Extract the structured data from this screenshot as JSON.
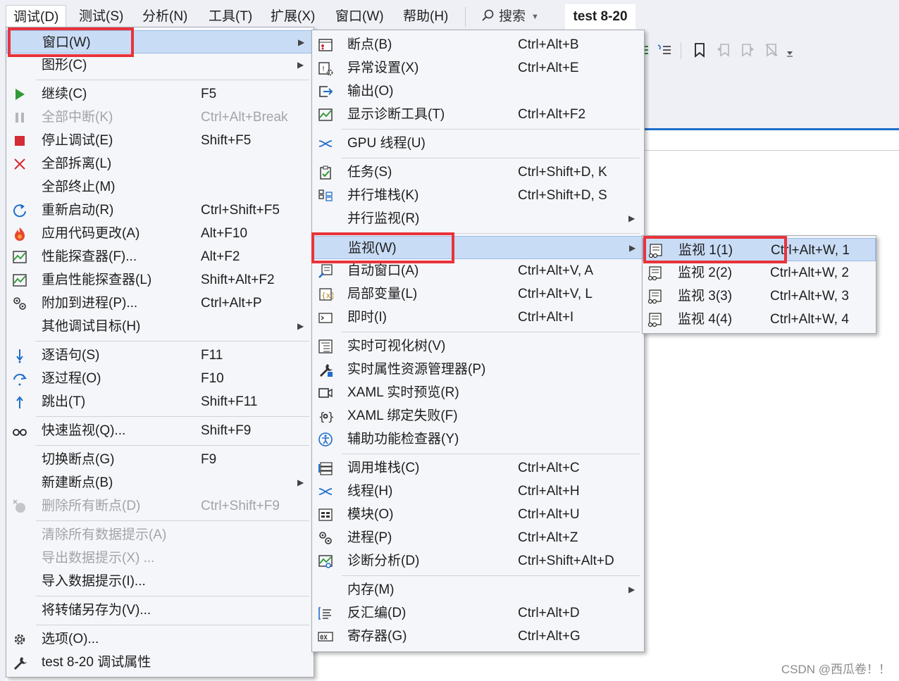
{
  "menubar": {
    "items": [
      "调试(D)",
      "测试(S)",
      "分析(N)",
      "工具(T)",
      "扩展(X)",
      "窗口(W)",
      "帮助(H)"
    ],
    "search_label": "搜索",
    "solution_title": "test 8-20"
  },
  "debug_menu": {
    "items": [
      {
        "label": "窗口(W)",
        "submenu": true,
        "highlighted": true,
        "icon": "none"
      },
      {
        "label": "图形(C)",
        "submenu": true,
        "icon": "none"
      },
      {
        "label": "继续(C)",
        "shortcut": "F5",
        "icon": "play-icon"
      },
      {
        "label": "全部中断(K)",
        "shortcut": "Ctrl+Alt+Break",
        "disabled": true,
        "icon": "pause-icon"
      },
      {
        "label": "停止调试(E)",
        "shortcut": "Shift+F5",
        "icon": "stop-icon"
      },
      {
        "label": "全部拆离(L)",
        "icon": "detach-icon"
      },
      {
        "label": "全部终止(M)",
        "icon": "none"
      },
      {
        "label": "重新启动(R)",
        "shortcut": "Ctrl+Shift+F5",
        "icon": "restart-icon"
      },
      {
        "label": "应用代码更改(A)",
        "shortcut": "Alt+F10",
        "icon": "hot-reload-icon"
      },
      {
        "label": "性能探查器(F)...",
        "shortcut": "Alt+F2",
        "icon": "profiler-icon"
      },
      {
        "label": "重启性能探查器(L)",
        "shortcut": "Shift+Alt+F2",
        "icon": "profiler-icon"
      },
      {
        "label": "附加到进程(P)...",
        "shortcut": "Ctrl+Alt+P",
        "icon": "attach-icon"
      },
      {
        "label": "其他调试目标(H)",
        "submenu": true,
        "icon": "none"
      },
      {
        "label": "逐语句(S)",
        "shortcut": "F11",
        "icon": "step-into-icon"
      },
      {
        "label": "逐过程(O)",
        "shortcut": "F10",
        "icon": "step-over-icon"
      },
      {
        "label": "跳出(T)",
        "shortcut": "Shift+F11",
        "icon": "step-out-icon"
      },
      {
        "label": "快速监视(Q)...",
        "shortcut": "Shift+F9",
        "icon": "glasses-icon"
      },
      {
        "label": "切换断点(G)",
        "shortcut": "F9",
        "icon": "none"
      },
      {
        "label": "新建断点(B)",
        "submenu": true,
        "icon": "none"
      },
      {
        "label": "删除所有断点(D)",
        "shortcut": "Ctrl+Shift+F9",
        "disabled": true,
        "icon": "delete-breakpoints-icon"
      },
      {
        "label": "清除所有数据提示(A)",
        "disabled": true,
        "icon": "none"
      },
      {
        "label": "导出数据提示(X) ...",
        "disabled": true,
        "icon": "none"
      },
      {
        "label": "导入数据提示(I)...",
        "icon": "none"
      },
      {
        "label": "将转储另存为(V)...",
        "icon": "none"
      },
      {
        "label": "选项(O)...",
        "icon": "gear-icon"
      },
      {
        "label": "test 8-20 调试属性",
        "icon": "wrench-icon"
      }
    ]
  },
  "window_submenu": {
    "items": [
      {
        "label": "断点(B)",
        "shortcut": "Ctrl+Alt+B",
        "icon": "breakpoints-window-icon"
      },
      {
        "label": "异常设置(X)",
        "shortcut": "Ctrl+Alt+E",
        "icon": "exception-settings-icon"
      },
      {
        "label": "输出(O)",
        "icon": "output-icon"
      },
      {
        "label": "显示诊断工具(T)",
        "shortcut": "Ctrl+Alt+F2",
        "icon": "diagnostic-tools-icon"
      },
      {
        "label": "GPU 线程(U)",
        "icon": "gpu-threads-icon"
      },
      {
        "label": "任务(S)",
        "shortcut": "Ctrl+Shift+D, K",
        "icon": "tasks-icon"
      },
      {
        "label": "并行堆栈(K)",
        "shortcut": "Ctrl+Shift+D, S",
        "icon": "parallel-stacks-icon"
      },
      {
        "label": "并行监视(R)",
        "submenu": true,
        "icon": "none"
      },
      {
        "label": "监视(W)",
        "submenu": true,
        "highlighted": true,
        "icon": "none"
      },
      {
        "label": "自动窗口(A)",
        "shortcut": "Ctrl+Alt+V, A",
        "icon": "autos-icon"
      },
      {
        "label": "局部变量(L)",
        "shortcut": "Ctrl+Alt+V, L",
        "icon": "locals-icon"
      },
      {
        "label": "即时(I)",
        "shortcut": "Ctrl+Alt+I",
        "icon": "immediate-icon"
      },
      {
        "label": "实时可视化树(V)",
        "icon": "live-visual-tree-icon"
      },
      {
        "label": "实时属性资源管理器(P)",
        "icon": "property-explorer-icon"
      },
      {
        "label": "XAML 实时预览(R)",
        "icon": "xaml-preview-icon"
      },
      {
        "label": "XAML 绑定失败(F)",
        "icon": "xaml-binding-icon"
      },
      {
        "label": "辅助功能检查器(Y)",
        "icon": "accessibility-icon"
      },
      {
        "label": "调用堆栈(C)",
        "shortcut": "Ctrl+Alt+C",
        "icon": "call-stack-icon"
      },
      {
        "label": "线程(H)",
        "shortcut": "Ctrl+Alt+H",
        "icon": "threads-icon"
      },
      {
        "label": "模块(O)",
        "shortcut": "Ctrl+Alt+U",
        "icon": "modules-icon"
      },
      {
        "label": "进程(P)",
        "shortcut": "Ctrl+Alt+Z",
        "icon": "processes-icon"
      },
      {
        "label": "诊断分析(D)",
        "shortcut": "Ctrl+Shift+Alt+D",
        "icon": "diagnostic-analysis-icon"
      },
      {
        "label": "内存(M)",
        "submenu": true,
        "icon": "none"
      },
      {
        "label": "反汇编(D)",
        "shortcut": "Ctrl+Alt+D",
        "icon": "disassembly-icon"
      },
      {
        "label": "寄存器(G)",
        "shortcut": "Ctrl+Alt+G",
        "icon": "registers-icon"
      }
    ]
  },
  "watch_submenu": {
    "items": [
      {
        "label": "监视 1(1)",
        "shortcut": "Ctrl+Alt+W, 1",
        "highlighted": true,
        "icon": "watch-icon"
      },
      {
        "label": "监视 2(2)",
        "shortcut": "Ctrl+Alt+W, 2",
        "icon": "watch-icon"
      },
      {
        "label": "监视 3(3)",
        "shortcut": "Ctrl+Alt+W, 3",
        "icon": "watch-icon"
      },
      {
        "label": "监视 4(4)",
        "shortcut": "Ctrl+Alt+W, 4",
        "icon": "watch-icon"
      }
    ]
  },
  "colors": {
    "menu_background": "#f5f6f9",
    "highlight": "#c9dcf5",
    "annotation_red": "#e8333b",
    "disabled_text": "#a2a4a8",
    "accent_blue": "#1f6ecb"
  },
  "watermark": "CSDN @西瓜卷！！"
}
